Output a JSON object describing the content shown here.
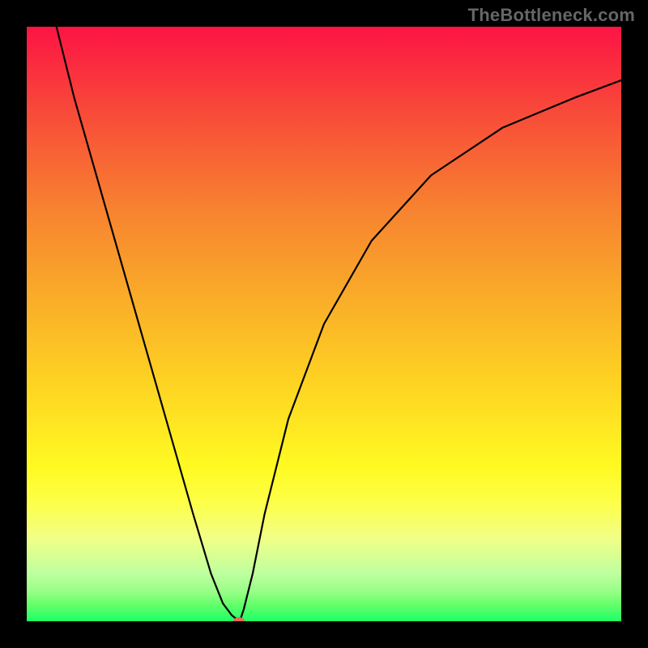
{
  "watermark": "TheBottleneck.com",
  "chart_data": {
    "type": "line",
    "title": "",
    "xlabel": "",
    "ylabel": "",
    "xlim": [
      0,
      100
    ],
    "ylim": [
      0,
      100
    ],
    "grid": false,
    "series": [
      {
        "name": "curve",
        "x": [
          5,
          8,
          12,
          16,
          20,
          24,
          28,
          31,
          33,
          34.5,
          35.5,
          36,
          36.5,
          38,
          40,
          44,
          50,
          58,
          68,
          80,
          92,
          100
        ],
        "y": [
          100,
          88,
          74,
          60,
          46,
          32,
          18,
          8,
          3,
          1,
          0.2,
          0.5,
          2,
          8,
          18,
          34,
          50,
          64,
          75,
          83,
          88,
          91
        ]
      }
    ],
    "marker": {
      "name": "min-point",
      "x": 35.7,
      "y": 0,
      "color": "#e76a5b",
      "rx": 7,
      "ry": 5
    },
    "background_gradient": {
      "top": "#fd1444",
      "bottom": "#1dff66"
    }
  }
}
